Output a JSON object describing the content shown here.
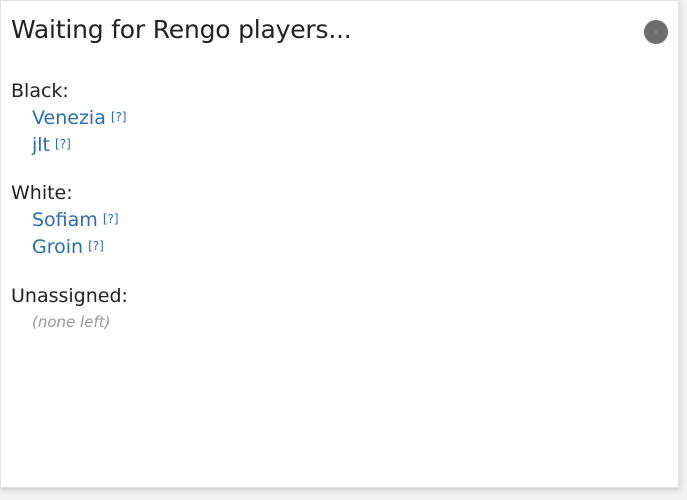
{
  "dialog": {
    "title": "Waiting for Rengo players...",
    "close_icon": "close-circle-icon"
  },
  "black": {
    "label": "Black:",
    "players": [
      {
        "name": "Venezia",
        "help": "[?]"
      },
      {
        "name": "jlt",
        "help": "[?]"
      }
    ]
  },
  "white": {
    "label": "White:",
    "players": [
      {
        "name": "Sofiam",
        "help": "[?]"
      },
      {
        "name": "Groin",
        "help": "[?]"
      }
    ]
  },
  "unassigned": {
    "label": "Unassigned:",
    "empty_text": "(none left)"
  },
  "colors": {
    "link": "#2a6db0",
    "muted": "#9a9a9a",
    "close_button": "#6e6e6e"
  }
}
